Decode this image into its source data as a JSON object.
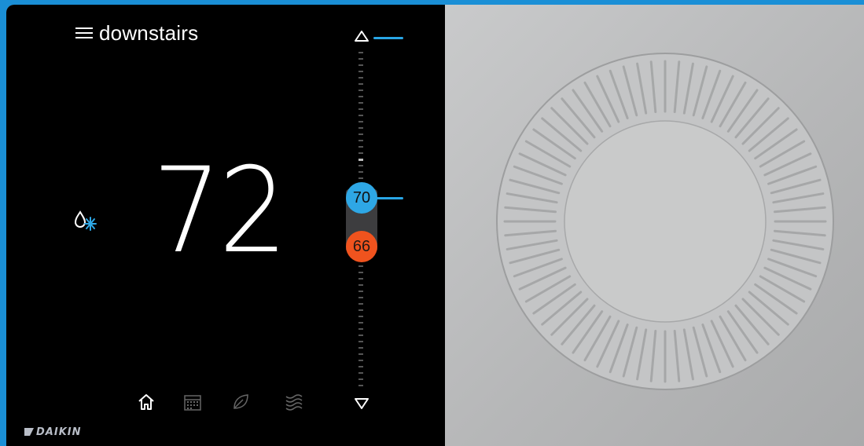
{
  "thermostat": {
    "zone_name": "downstairs",
    "current_temperature": "72",
    "mode_icon": "heat-cool-auto-icon",
    "setpoints": {
      "cool": "70",
      "heat": "66"
    },
    "scale": {
      "up_icon": "triangle-up-icon",
      "down_icon": "triangle-down-icon"
    },
    "nav": [
      {
        "icon": "home-icon"
      },
      {
        "icon": "calendar-icon"
      },
      {
        "icon": "leaf-icon"
      },
      {
        "icon": "waves-icon"
      }
    ],
    "brand": "DAIKIN"
  },
  "colors": {
    "background": "#1a8fd6",
    "cool": "#2ea7e5",
    "heat": "#f0531e",
    "screen": "#000000",
    "device_body": "#bfc0c1"
  }
}
